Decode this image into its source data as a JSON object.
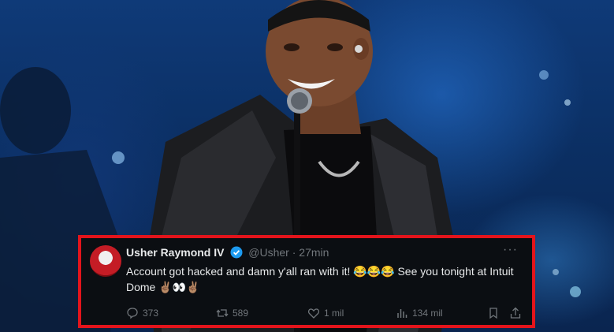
{
  "tweet": {
    "name": "Usher Raymond IV",
    "handle": "@Usher",
    "separator": "·",
    "time": "27min",
    "more": "···",
    "text": "Account got hacked and damn y'all ran with it! 😂😂😂 See you tonight at Intuit Dome ✌🏽👀✌🏽",
    "replies": "373",
    "reposts": "589",
    "likes": "1 mil",
    "views": "134 mil"
  },
  "colors": {
    "frame": "#e3141b",
    "card": "#0b0e12",
    "verified": "#1d9bf0",
    "muted": "#71767b"
  }
}
